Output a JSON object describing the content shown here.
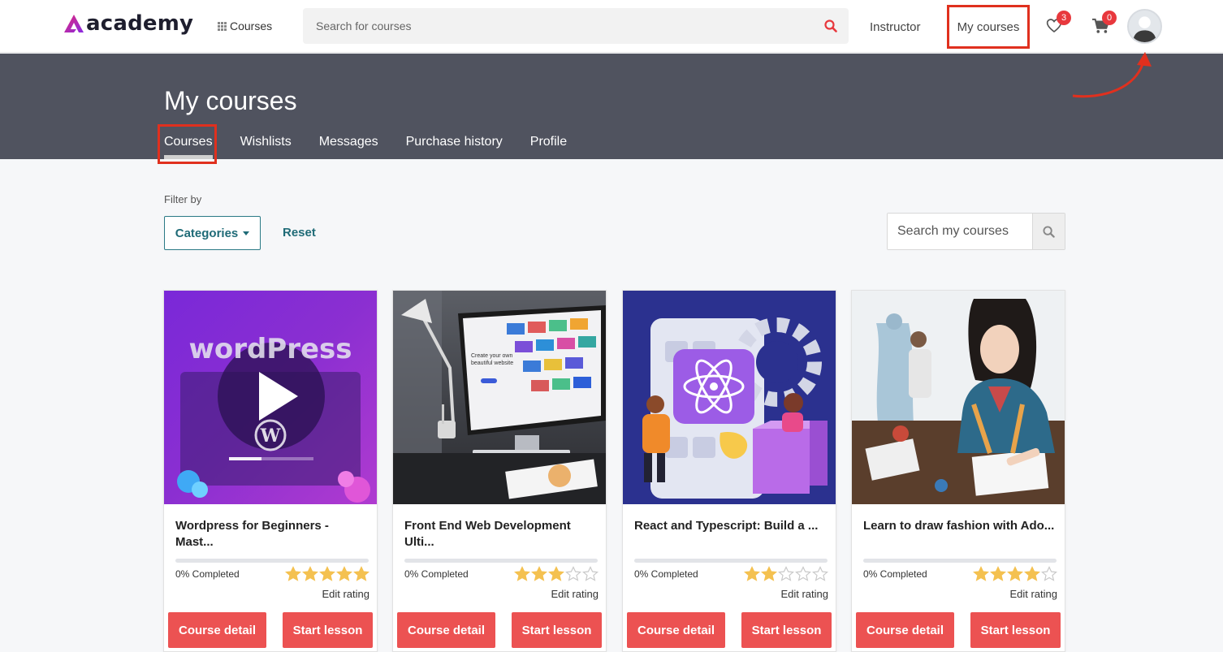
{
  "brand": {
    "logo_text": "academy",
    "accent": "#ec5252",
    "teal": "#1f6b77",
    "band_color": "#50535f"
  },
  "topnav": {
    "courses_label": "Courses",
    "search_placeholder": "Search for courses",
    "instructor_label": "Instructor",
    "my_courses_label": "My courses",
    "wishlist_count": "3",
    "cart_count": "0"
  },
  "header": {
    "title": "My courses",
    "tabs": [
      {
        "label": "Courses"
      },
      {
        "label": "Wishlists"
      },
      {
        "label": "Messages"
      },
      {
        "label": "Purchase history"
      },
      {
        "label": "Profile"
      }
    ]
  },
  "filter": {
    "label": "Filter by",
    "categories_label": "Categories",
    "reset_label": "Reset",
    "search_placeholder": "Search my courses"
  },
  "courses": [
    {
      "title": "Wordpress for Beginners - Mast...",
      "progress_text": "0% Completed",
      "progress": 0,
      "rating": 5,
      "thumb_text": "wordPress",
      "thumb_caption": "",
      "edit_rating": "Edit rating",
      "detail_label": "Course detail",
      "lesson_label": "Start lesson"
    },
    {
      "title": "Front End Web Development Ulti...",
      "progress_text": "0% Completed",
      "progress": 0,
      "rating": 3,
      "thumb_text": "",
      "thumb_caption": "Create your own beautiful website",
      "edit_rating": "Edit rating",
      "detail_label": "Course detail",
      "lesson_label": "Start lesson"
    },
    {
      "title": "React and Typescript: Build a ...",
      "progress_text": "0% Completed",
      "progress": 0,
      "rating": 2,
      "thumb_text": "",
      "thumb_caption": "",
      "edit_rating": "Edit rating",
      "detail_label": "Course detail",
      "lesson_label": "Start lesson"
    },
    {
      "title": "Learn to draw fashion with Ado...",
      "progress_text": "0% Completed",
      "progress": 0,
      "rating": 4,
      "thumb_text": "",
      "thumb_caption": "",
      "edit_rating": "Edit rating",
      "detail_label": "Course detail",
      "lesson_label": "Start lesson"
    }
  ]
}
